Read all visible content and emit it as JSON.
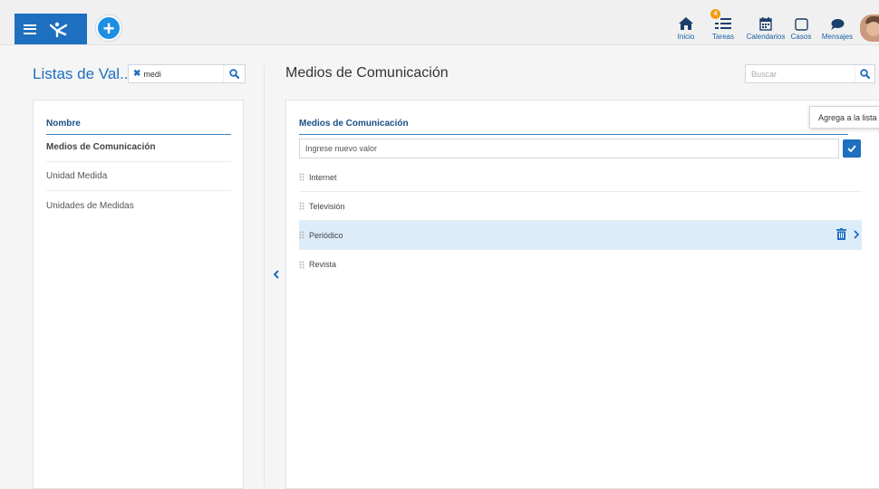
{
  "header": {
    "add_label": "+",
    "nav": [
      {
        "icon": "home-icon",
        "label": "Inicio"
      },
      {
        "icon": "tasks-icon",
        "label": "Tareas",
        "badge": "4"
      },
      {
        "icon": "calendar-icon",
        "label": "Calendarios"
      },
      {
        "icon": "cases-icon",
        "label": "Casos"
      },
      {
        "icon": "message-icon",
        "label": "Mensajes"
      }
    ]
  },
  "left": {
    "title": "Listas de Val...",
    "filter_value": "medi",
    "column_header": "Nombre",
    "items": [
      {
        "label": "Medios de Comunicación",
        "active": true
      },
      {
        "label": "Unidad Medida",
        "active": false
      },
      {
        "label": "Unidades de Medidas",
        "active": false
      }
    ]
  },
  "right": {
    "title": "Medios de Comunicación",
    "search_placeholder": "Buscar",
    "column_header": "Medios de Comunicación",
    "new_value_placeholder": "Ingrese nuevo valor",
    "tooltip": "Agrega a la lista",
    "values": [
      {
        "label": "Internet",
        "selected": false
      },
      {
        "label": "Televisión",
        "selected": false
      },
      {
        "label": "Periódico",
        "selected": true
      },
      {
        "label": "Revista",
        "selected": false
      }
    ]
  },
  "colors": {
    "primary": "#1e6fbf",
    "accent": "#1e8ee3",
    "selected_row": "#dcecf8",
    "badge": "#f39c12"
  }
}
